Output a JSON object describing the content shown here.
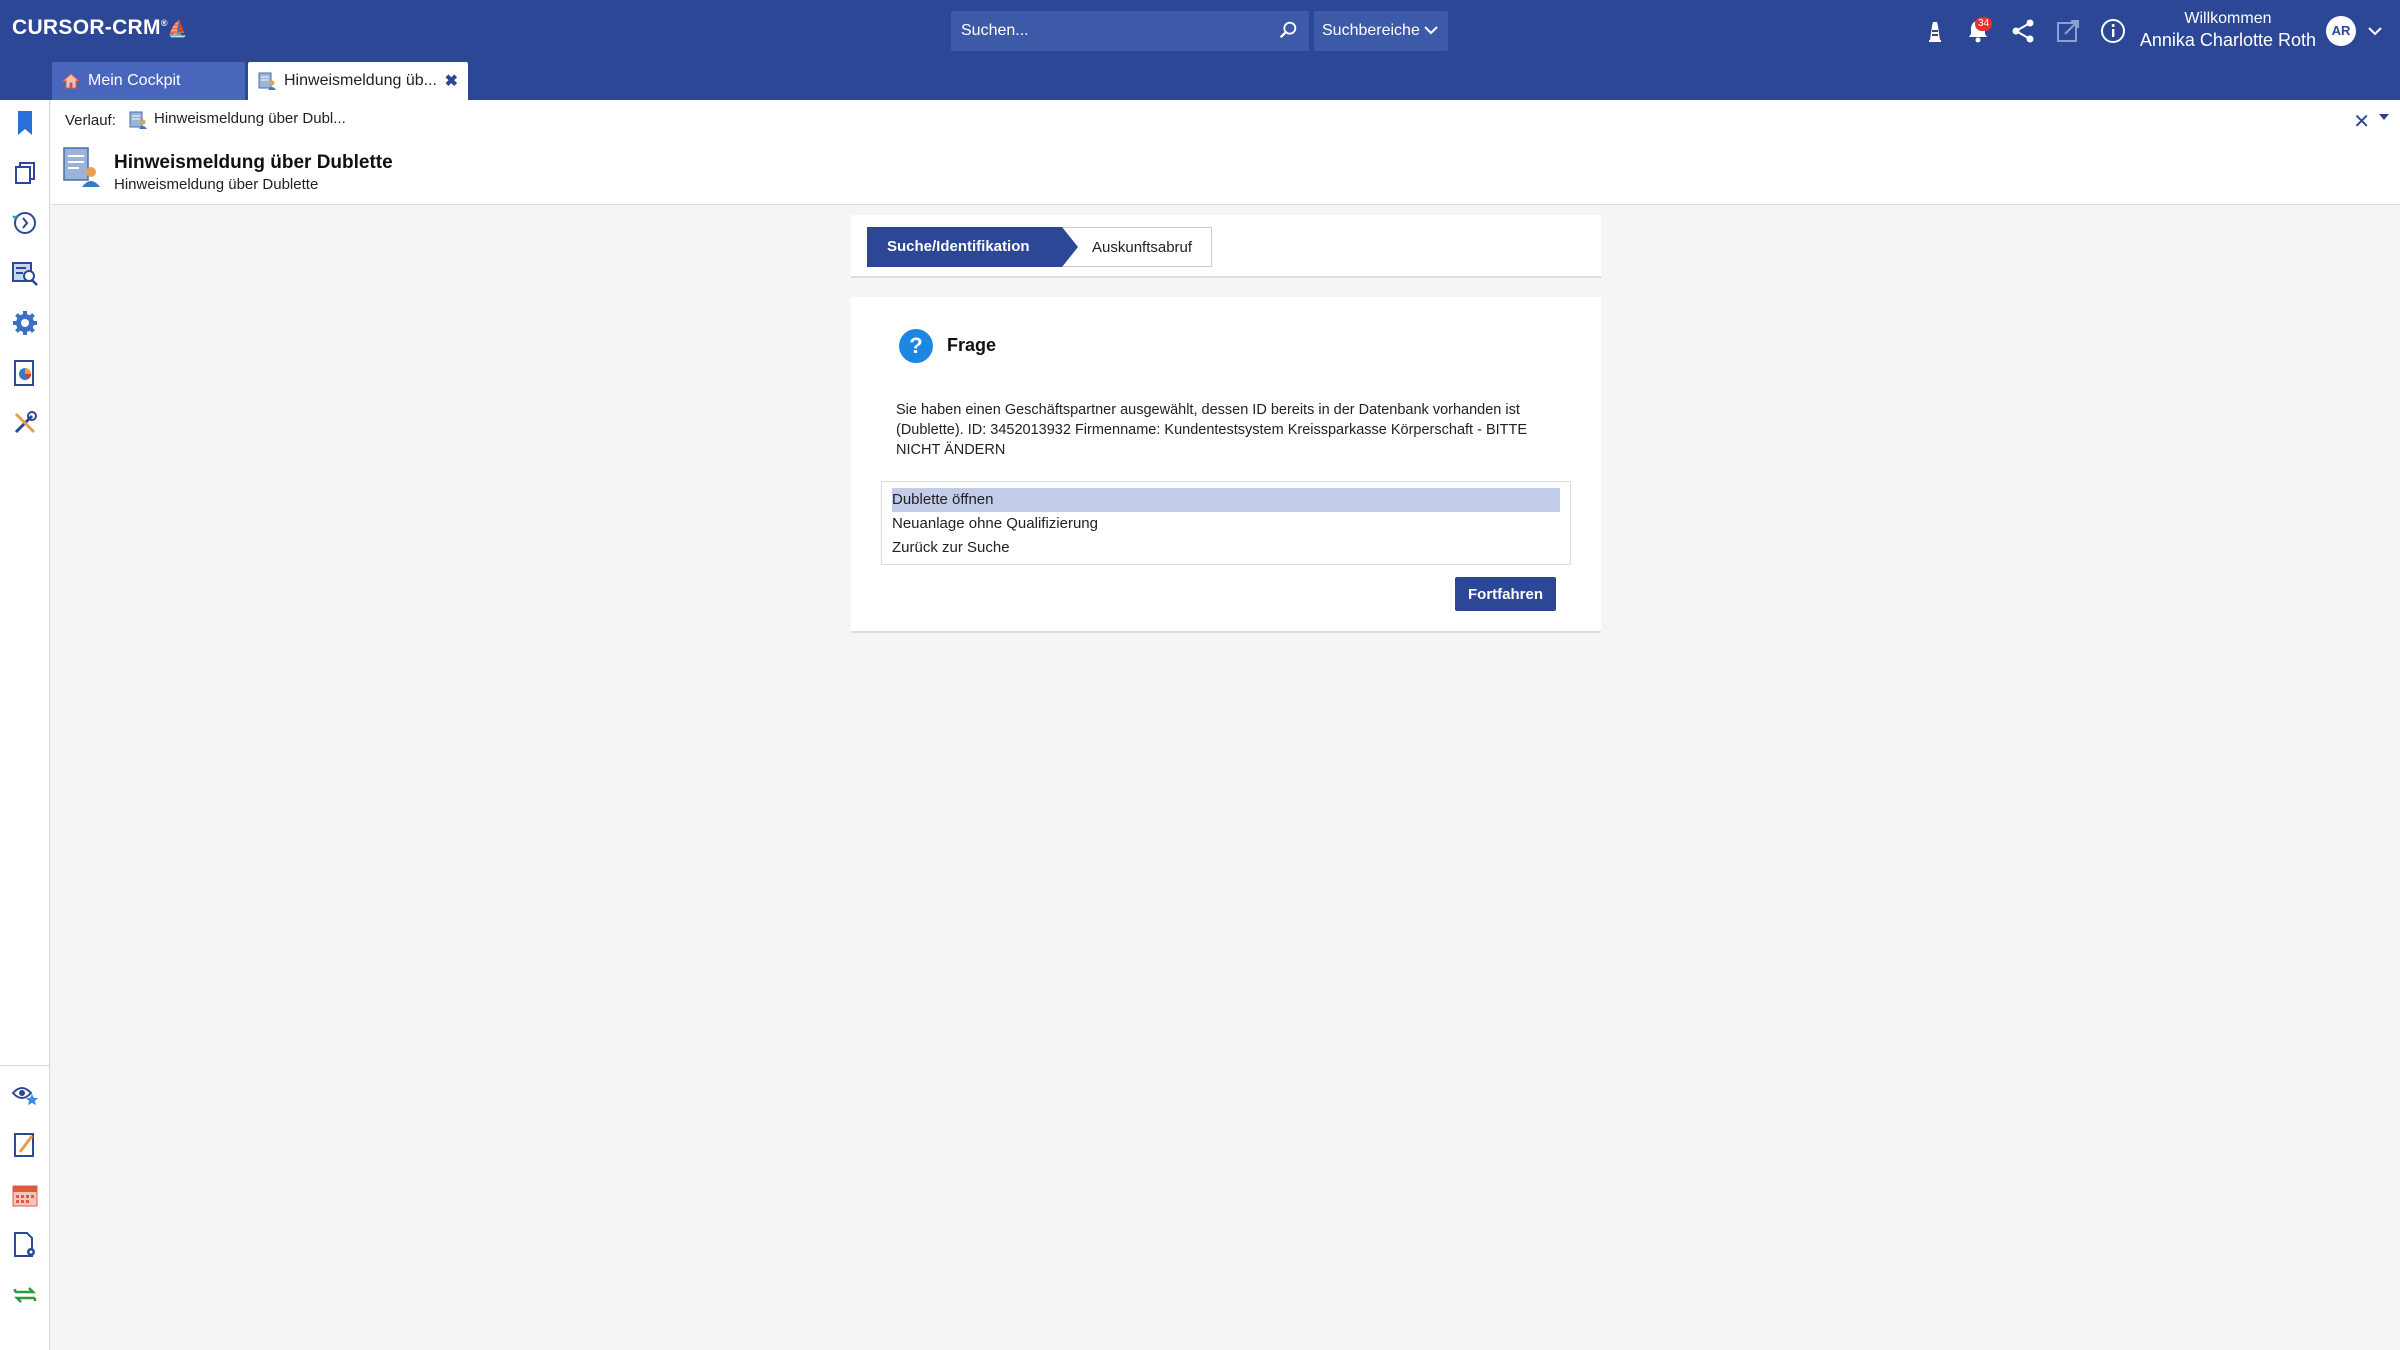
{
  "app": {
    "logo": "CURSOR-CRM",
    "search_placeholder": "Suchen...",
    "search_areas_label": "Suchbereiche",
    "notification_count": "34",
    "welcome_label": "Willkommen",
    "user_name": "Annika Charlotte Roth",
    "user_initials": "AR"
  },
  "tabs": [
    {
      "label": "Mein Cockpit",
      "active": false
    },
    {
      "label": "Hinweismeldung üb...",
      "active": true
    }
  ],
  "header": {
    "history_label": "Verlauf:",
    "history_item": "Hinweismeldung über Dubl...",
    "title": "Hinweismeldung über Dublette",
    "subtitle": "Hinweismeldung über Dublette"
  },
  "steps": [
    {
      "label": "Suche/Identifikation",
      "active": true
    },
    {
      "label": "Auskunftsabruf",
      "active": false
    }
  ],
  "dialog": {
    "title": "Frage",
    "message": "Sie haben einen Geschäftspartner ausgewählt, dessen ID bereits in der Datenbank vorhanden ist (Dublette). ID: 3452013932 Firmenname: Kundentestsystem Kreissparkasse Körperschaft - BITTE NICHT ÄNDERN",
    "options": [
      {
        "label": "Dublette öffnen",
        "selected": true
      },
      {
        "label": "Neuanlage ohne Qualifizierung",
        "selected": false
      },
      {
        "label": "Zurück zur Suche",
        "selected": false
      }
    ],
    "continue_label": "Fortfahren"
  },
  "colors": {
    "primary": "#2c4796",
    "tab_inactive": "#4766bc",
    "selection": "#c2cbe8",
    "question_icon": "#1c86e3",
    "badge": "#e2342d"
  },
  "sidebar_icons": [
    "bookmark-icon",
    "copy-icon",
    "history-icon",
    "search-list-icon",
    "gear-icon",
    "report-icon",
    "tools-icon",
    "watch-star-icon",
    "edit-icon",
    "calendar-icon",
    "document-settings-icon",
    "sync-icon"
  ]
}
